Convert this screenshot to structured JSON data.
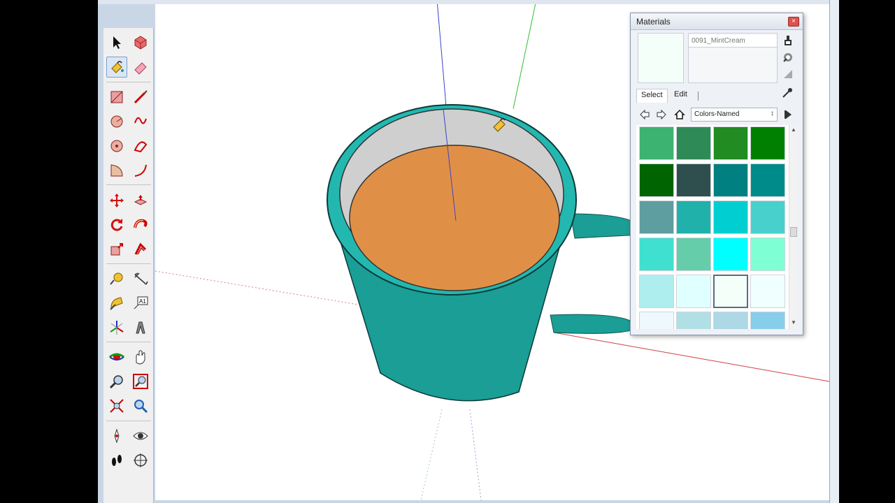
{
  "materials": {
    "title": "Materials",
    "close_glyph": "×",
    "material_name_placeholder": "0091_MintCream",
    "preview_color": "#f5fffa",
    "tabs": {
      "select": "Select",
      "edit": "Edit"
    },
    "collection": "Colors-Named",
    "icons": [
      "create-material-icon",
      "sample-paint-icon",
      "display-secondary-pane-icon",
      "eyedropper-icon",
      "back-icon",
      "forward-icon",
      "home-icon",
      "details-icon"
    ],
    "swatches": [
      "#3cb371",
      "#2e8b57",
      "#228b22",
      "#008000",
      "#006400",
      "#2f4f4f",
      "#008080",
      "#008b8b",
      "#5f9ea0",
      "#20b2aa",
      "#00ced1",
      "#48d1cc",
      "#40e0d0",
      "#66cdaa",
      "#00ffff",
      "#7fffd4",
      "#afeeee",
      "#e0ffff",
      "#f5fffa",
      "#f0ffff",
      "#f0f8ff",
      "#b0e0e6",
      "#add8e6",
      "#87ceeb"
    ],
    "selected_swatch": "#f5fffa"
  },
  "toolbar": {
    "tools": [
      "select-tool-icon",
      "make-component-icon",
      "paint-bucket-icon",
      "eraser-icon",
      "rectangle-icon",
      "line-icon",
      "circle-icon",
      "arc-icon",
      "polygon-icon",
      "freehand-icon",
      "pie-icon",
      "two-point-arc-icon",
      "move-icon",
      "push-pull-icon",
      "rotate-icon",
      "follow-me-icon",
      "scale-icon",
      "offset-icon",
      "tape-measure-icon",
      "dimension-icon",
      "protractor-icon",
      "text-icon",
      "axes-icon",
      "3d-text-icon",
      "orbit-icon",
      "pan-icon",
      "zoom-icon",
      "zoom-window-icon",
      "zoom-extents-icon",
      "previous-view-icon",
      "position-camera-icon",
      "look-around-icon",
      "walk-icon",
      "section-plane-icon"
    ],
    "active_tool": "paint-bucket-icon"
  },
  "scene": {
    "mug_color": "#1a9e96",
    "rim_color": "#20b8b0",
    "liquid_color": "#e09046",
    "inner_wall_color": "#d9d9d9"
  }
}
